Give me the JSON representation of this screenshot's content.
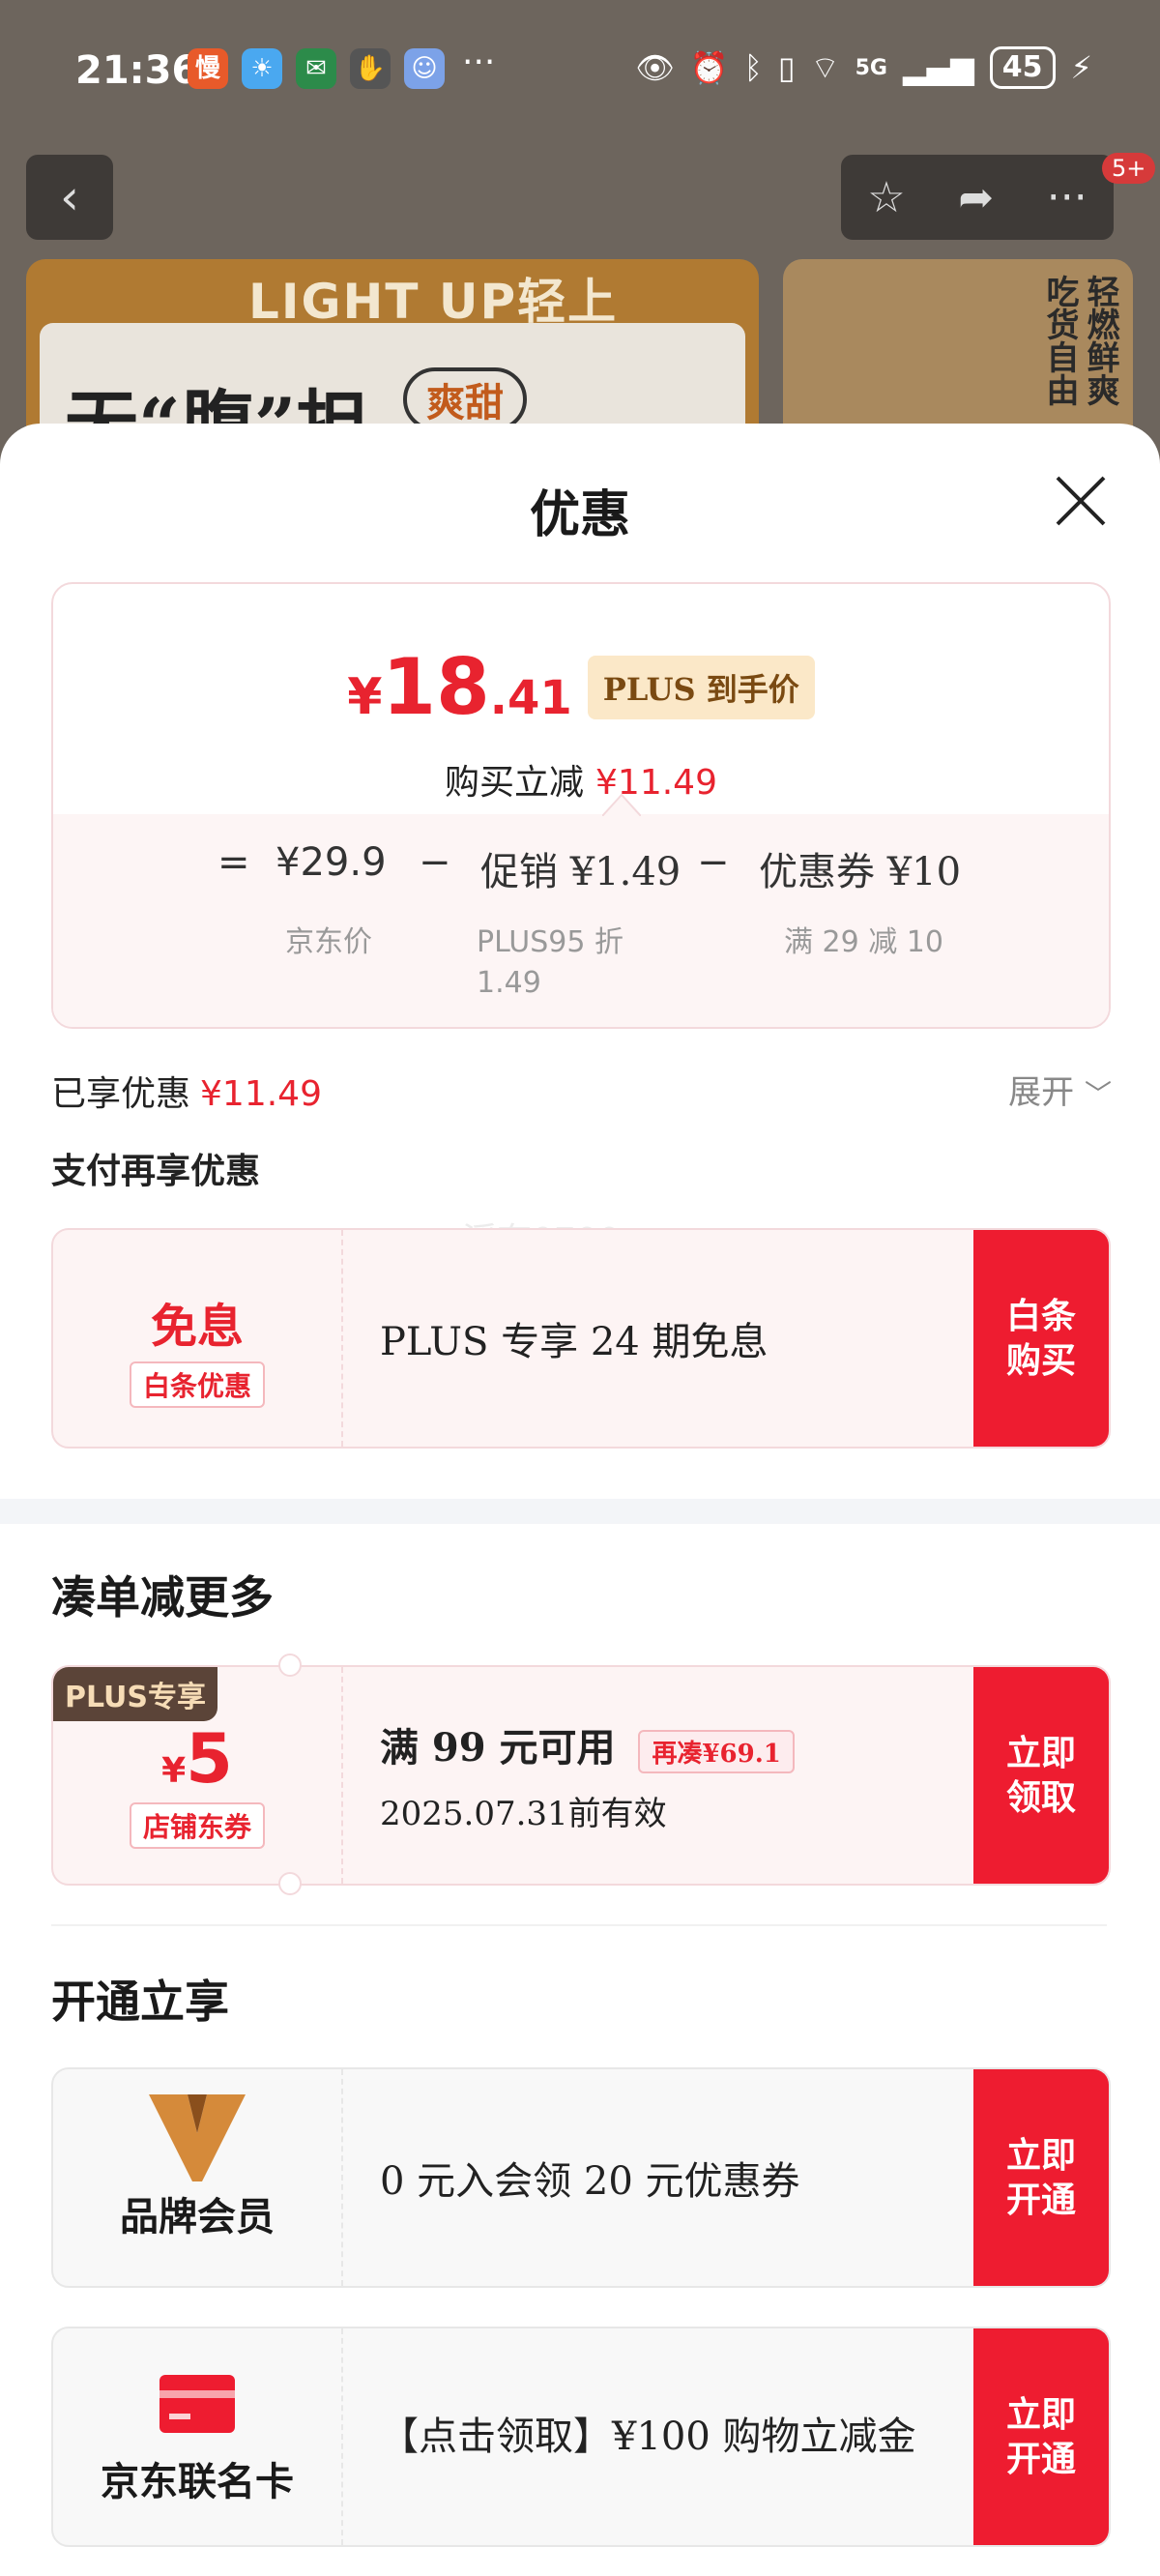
{
  "status": {
    "time": "21:36",
    "app_icons": [
      "慢",
      "",
      "",
      "",
      ""
    ],
    "more": "···",
    "network": "5G",
    "battery": "45"
  },
  "background": {
    "banner_brand": "LIGHT UP轻上",
    "banner_slogan": "无“腹”担",
    "banner_pill": "爽甜",
    "right_text_col1": "轻燃鲜爽",
    "right_text_col2": "吃货自由",
    "nav_badge": "5+"
  },
  "sheet": {
    "title": "优惠"
  },
  "summary": {
    "price_currency": "¥",
    "price_int": "18",
    "price_dec": ".41",
    "plus_tag": "PLUS 到手价",
    "reduce_label": "购买立减",
    "reduce_value": "¥11.49",
    "eq": "=",
    "jd_price": "¥29.9",
    "minus1": "−",
    "promo": "促销 ¥1.49",
    "minus2": "−",
    "coupon": "优惠券 ¥10",
    "jd_price_label": "京东价",
    "promo_label_1": "PLUS95 折",
    "promo_label_2": "1.49",
    "coupon_label": "满 29 减 10"
  },
  "enjoyed": {
    "label": "已享优惠",
    "value": "¥11.49",
    "expand": "展开"
  },
  "pay_more": {
    "title": "支付再享优惠",
    "watermark": "浮夸0700",
    "card": {
      "badge_main": "免息",
      "badge_sub": "白条优惠",
      "text": "PLUS 专享 24 期免息",
      "action": "白条\n购买"
    }
  },
  "bundle": {
    "title": "凑单减更多",
    "card": {
      "corner": "PLUS专享",
      "currency": "¥",
      "amount": "5",
      "sub": "店铺东券",
      "condition": "满 99 元可用",
      "tag": "再凑¥69.1",
      "validity": "2025.07.31前有效",
      "action": "立即\n领取"
    }
  },
  "open": {
    "title": "开通立享",
    "cards": [
      {
        "name": "品牌会员",
        "text": "0 元入会领 20 元优惠券",
        "action": "立即\n开通"
      },
      {
        "name": "京东联名卡",
        "text": "【点击领取】¥100 购物立减金",
        "action": "立即\n开通"
      }
    ]
  },
  "colors": {
    "accent": "#e8232f",
    "action_bg": "#ee1c30",
    "plus_tag_bg": "#fbe8c8"
  }
}
